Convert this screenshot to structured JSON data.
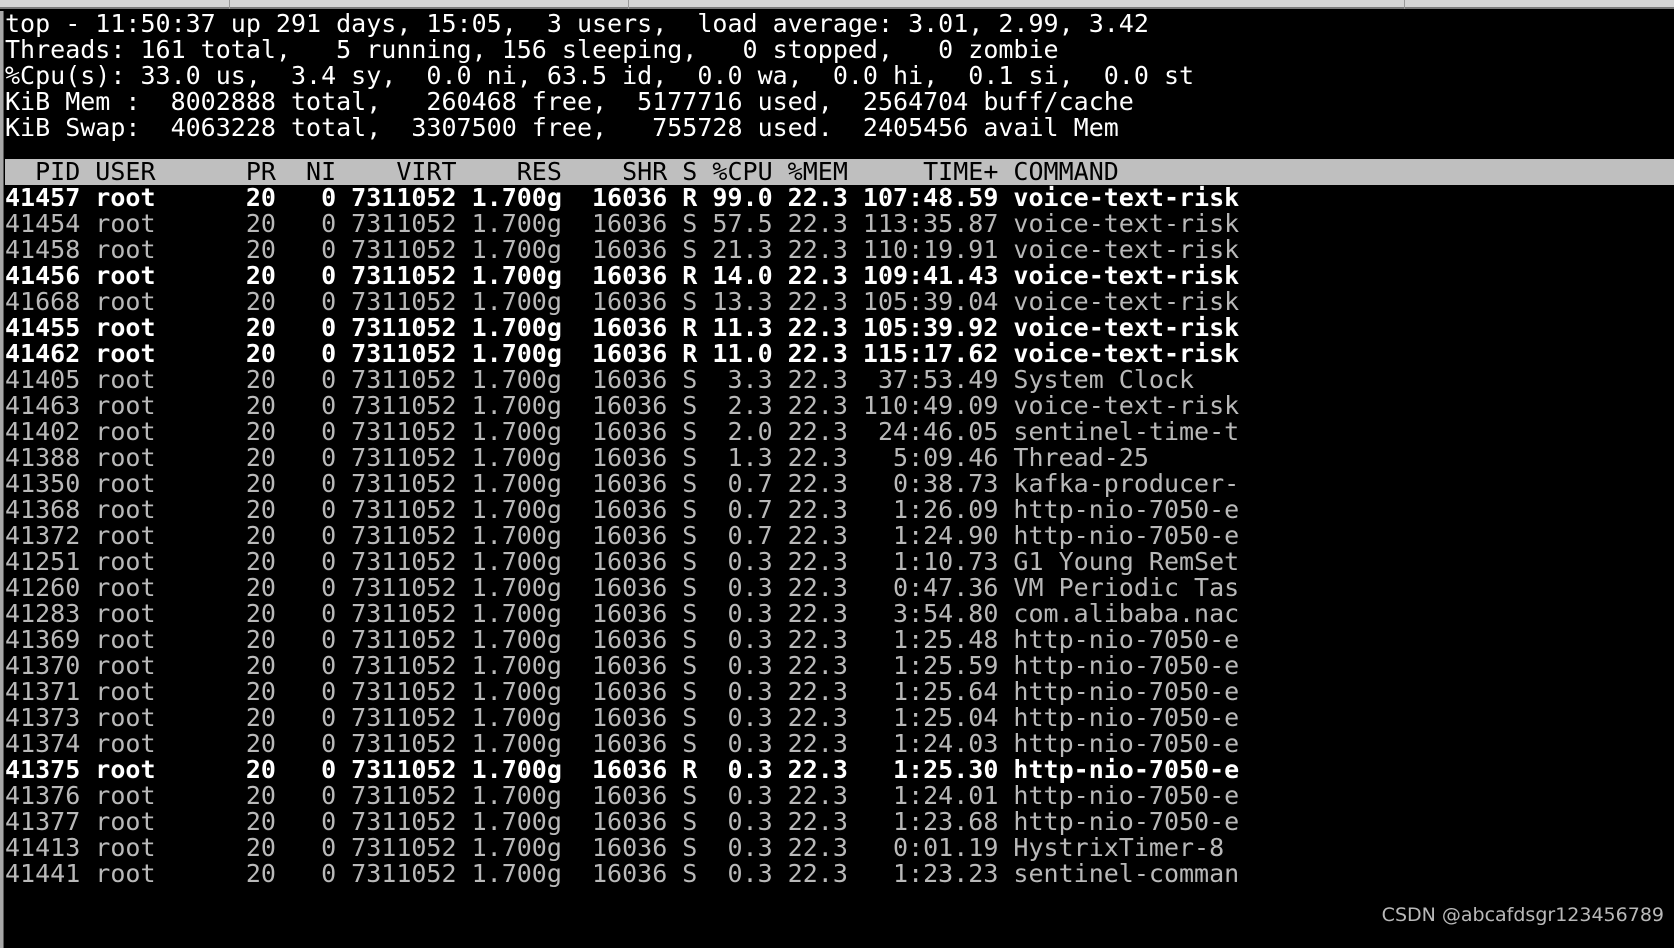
{
  "window": {
    "chrome_strip": true
  },
  "summary": {
    "line1": "top - 11:50:37 up 291 days, 15:05,  3 users,  load average: 3.01, 2.99, 3.42",
    "line2": "Threads: 161 total,   5 running, 156 sleeping,   0 stopped,   0 zombie",
    "line3": "%Cpu(s): 33.0 us,  3.4 sy,  0.0 ni, 63.5 id,  0.0 wa,  0.0 hi,  0.1 si,  0.0 st",
    "line4": "KiB Mem :  8002888 total,   260468 free,  5177716 used,  2564704 buff/cache",
    "line5": "KiB Swap:  4063228 total,  3307500 free,   755728 used.  2405456 avail Mem",
    "fields": {
      "time": "11:50:37",
      "uptime_days": 291,
      "uptime_clock": "15:05",
      "users": 3,
      "load_average": [
        3.01,
        2.99,
        3.42
      ],
      "threads_total": 161,
      "threads_running": 5,
      "threads_sleeping": 156,
      "threads_stopped": 0,
      "threads_zombie": 0,
      "cpu_us": 33.0,
      "cpu_sy": 3.4,
      "cpu_ni": 0.0,
      "cpu_id": 63.5,
      "cpu_wa": 0.0,
      "cpu_hi": 0.0,
      "cpu_si": 0.1,
      "cpu_st": 0.0,
      "mem_total": 8002888,
      "mem_free": 260468,
      "mem_used": 5177716,
      "mem_buff_cache": 2564704,
      "swap_total": 4063228,
      "swap_free": 3307500,
      "swap_used": 755728,
      "avail_mem": 2405456
    }
  },
  "table": {
    "header_line": "  PID USER      PR  NI    VIRT    RES    SHR S %CPU %MEM     TIME+ COMMAND",
    "columns": [
      "PID",
      "USER",
      "PR",
      "NI",
      "VIRT",
      "RES",
      "SHR",
      "S",
      "%CPU",
      "%MEM",
      "TIME+",
      "COMMAND"
    ],
    "rows": [
      {
        "line": "41457 root      20   0 7311052 1.700g  16036 R 99.0 22.3 107:48.59 voice-text-risk",
        "state": "R"
      },
      {
        "line": "41454 root      20   0 7311052 1.700g  16036 S 57.5 22.3 113:35.87 voice-text-risk",
        "state": "S"
      },
      {
        "line": "41458 root      20   0 7311052 1.700g  16036 S 21.3 22.3 110:19.91 voice-text-risk",
        "state": "S"
      },
      {
        "line": "41456 root      20   0 7311052 1.700g  16036 R 14.0 22.3 109:41.43 voice-text-risk",
        "state": "R"
      },
      {
        "line": "41668 root      20   0 7311052 1.700g  16036 S 13.3 22.3 105:39.04 voice-text-risk",
        "state": "S"
      },
      {
        "line": "41455 root      20   0 7311052 1.700g  16036 R 11.3 22.3 105:39.92 voice-text-risk",
        "state": "R"
      },
      {
        "line": "41462 root      20   0 7311052 1.700g  16036 R 11.0 22.3 115:17.62 voice-text-risk",
        "state": "R"
      },
      {
        "line": "41405 root      20   0 7311052 1.700g  16036 S  3.3 22.3  37:53.49 System Clock",
        "state": "S"
      },
      {
        "line": "41463 root      20   0 7311052 1.700g  16036 S  2.3 22.3 110:49.09 voice-text-risk",
        "state": "S"
      },
      {
        "line": "41402 root      20   0 7311052 1.700g  16036 S  2.0 22.3  24:46.05 sentinel-time-t",
        "state": "S"
      },
      {
        "line": "41388 root      20   0 7311052 1.700g  16036 S  1.3 22.3   5:09.46 Thread-25",
        "state": "S"
      },
      {
        "line": "41350 root      20   0 7311052 1.700g  16036 S  0.7 22.3   0:38.73 kafka-producer-",
        "state": "S"
      },
      {
        "line": "41368 root      20   0 7311052 1.700g  16036 S  0.7 22.3   1:26.09 http-nio-7050-e",
        "state": "S"
      },
      {
        "line": "41372 root      20   0 7311052 1.700g  16036 S  0.7 22.3   1:24.90 http-nio-7050-e",
        "state": "S"
      },
      {
        "line": "41251 root      20   0 7311052 1.700g  16036 S  0.3 22.3   1:10.73 G1 Young RemSet",
        "state": "S"
      },
      {
        "line": "41260 root      20   0 7311052 1.700g  16036 S  0.3 22.3   0:47.36 VM Periodic Tas",
        "state": "S"
      },
      {
        "line": "41283 root      20   0 7311052 1.700g  16036 S  0.3 22.3   3:54.80 com.alibaba.nac",
        "state": "S"
      },
      {
        "line": "41369 root      20   0 7311052 1.700g  16036 S  0.3 22.3   1:25.48 http-nio-7050-e",
        "state": "S"
      },
      {
        "line": "41370 root      20   0 7311052 1.700g  16036 S  0.3 22.3   1:25.59 http-nio-7050-e",
        "state": "S"
      },
      {
        "line": "41371 root      20   0 7311052 1.700g  16036 S  0.3 22.3   1:25.64 http-nio-7050-e",
        "state": "S"
      },
      {
        "line": "41373 root      20   0 7311052 1.700g  16036 S  0.3 22.3   1:25.04 http-nio-7050-e",
        "state": "S"
      },
      {
        "line": "41374 root      20   0 7311052 1.700g  16036 S  0.3 22.3   1:24.03 http-nio-7050-e",
        "state": "S"
      },
      {
        "line": "41375 root      20   0 7311052 1.700g  16036 R  0.3 22.3   1:25.30 http-nio-7050-e",
        "state": "R"
      },
      {
        "line": "41376 root      20   0 7311052 1.700g  16036 S  0.3 22.3   1:24.01 http-nio-7050-e",
        "state": "S"
      },
      {
        "line": "41377 root      20   0 7311052 1.700g  16036 S  0.3 22.3   1:23.68 http-nio-7050-e",
        "state": "S"
      },
      {
        "line": "41413 root      20   0 7311052 1.700g  16036 S  0.3 22.3   0:01.19 HystrixTimer-8",
        "state": "S"
      },
      {
        "line": "41441 root      20   0 7311052 1.700g  16036 S  0.3 22.3   1:23.23 sentinel-comman",
        "state": "S"
      }
    ]
  },
  "watermark": {
    "text": "CSDN @abcafdsgr123456789"
  },
  "colors": {
    "background": "#000000",
    "foreground_dim": "#b9b9b9",
    "foreground_bright": "#ffffff",
    "header_bar_bg": "#bfbfbf",
    "header_bar_fg": "#000000"
  }
}
